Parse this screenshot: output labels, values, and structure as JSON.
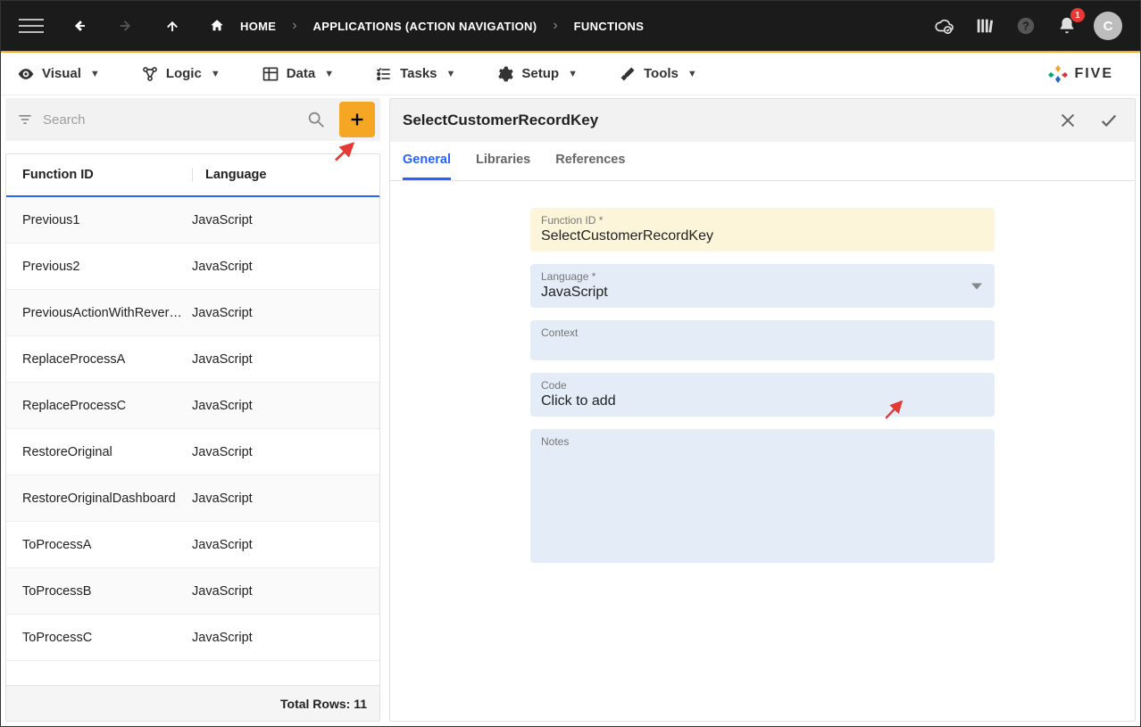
{
  "topbar": {
    "breadcrumbs": [
      "HOME",
      "APPLICATIONS (ACTION NAVIGATION)",
      "FUNCTIONS"
    ],
    "notification_count": "1",
    "avatar_initial": "C"
  },
  "menubar": {
    "items": [
      "Visual",
      "Logic",
      "Data",
      "Tasks",
      "Setup",
      "Tools"
    ],
    "brand": "FIVE"
  },
  "search": {
    "placeholder": "Search"
  },
  "table": {
    "headers": {
      "col1": "Function ID",
      "col2": "Language"
    },
    "rows": [
      {
        "id": "Previous1",
        "lang": "JavaScript"
      },
      {
        "id": "Previous2",
        "lang": "JavaScript"
      },
      {
        "id": "PreviousActionWithRever…",
        "lang": "JavaScript"
      },
      {
        "id": "ReplaceProcessA",
        "lang": "JavaScript"
      },
      {
        "id": "ReplaceProcessC",
        "lang": "JavaScript"
      },
      {
        "id": "RestoreOriginal",
        "lang": "JavaScript"
      },
      {
        "id": "RestoreOriginalDashboard",
        "lang": "JavaScript"
      },
      {
        "id": "ToProcessA",
        "lang": "JavaScript"
      },
      {
        "id": "ToProcessB",
        "lang": "JavaScript"
      },
      {
        "id": "ToProcessC",
        "lang": "JavaScript"
      }
    ],
    "footer": "Total Rows: 11"
  },
  "detail": {
    "title": "SelectCustomerRecordKey",
    "tabs": [
      "General",
      "Libraries",
      "References"
    ],
    "fields": {
      "function_id_label": "Function ID *",
      "function_id_value": "SelectCustomerRecordKey",
      "language_label": "Language *",
      "language_value": "JavaScript",
      "context_label": "Context",
      "context_value": "",
      "code_label": "Code",
      "code_value": "Click to add",
      "notes_label": "Notes",
      "notes_value": ""
    }
  }
}
